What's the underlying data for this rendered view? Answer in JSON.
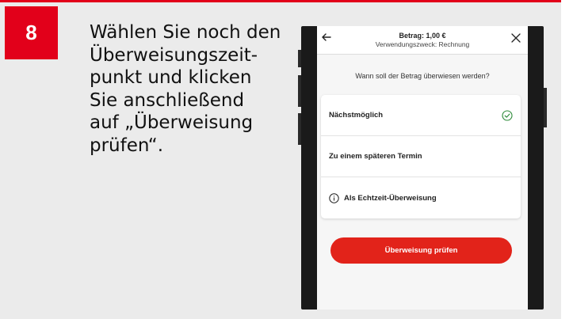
{
  "step": {
    "number": "8"
  },
  "instruction": {
    "lines": [
      "Wählen Sie noch den",
      "Überweisungszeit-",
      "punkt und klicken",
      "Sie anschließend",
      "auf „Überweisung",
      "prüfen“."
    ]
  },
  "app": {
    "header": {
      "amount": "Betrag: 1,00 €",
      "purpose": "Verwendungszweck: Rechnung"
    },
    "question": "Wann soll der Betrag überwiesen werden?",
    "options": [
      {
        "label": "Nächstmöglich",
        "selected": true
      },
      {
        "label": "Zu einem späteren Termin",
        "selected": false
      },
      {
        "label": "Als Echtzeit-Überweisung",
        "selected": false,
        "icon": "info-icon"
      }
    ],
    "cta_label": "Überweisung prüfen"
  },
  "colors": {
    "accent": "#e2001a",
    "check": "#2e8b3a",
    "card_bg": "#ebebeb"
  }
}
